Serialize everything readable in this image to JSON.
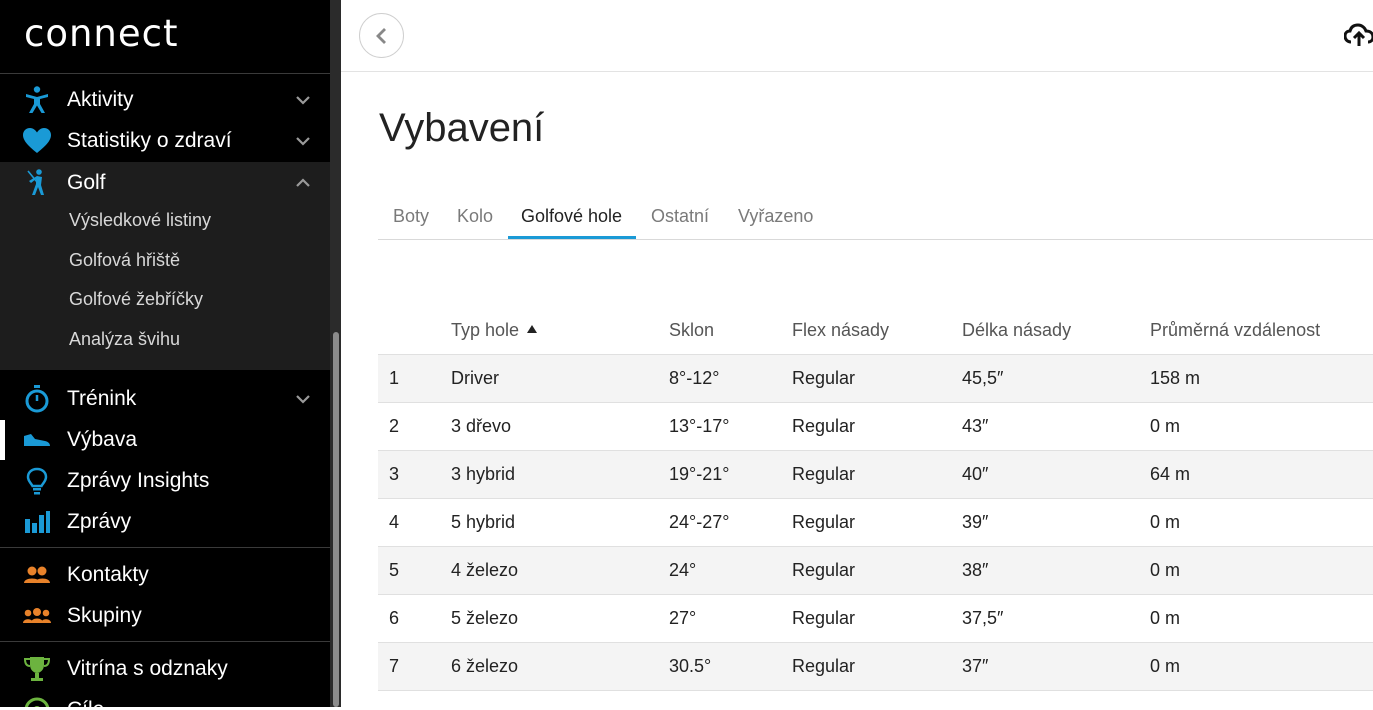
{
  "app": {
    "logo_text": "connect"
  },
  "sidebar": {
    "items": [
      {
        "label": "Aktivity",
        "icon": "running-figure-icon",
        "expandable": true,
        "expanded": false
      },
      {
        "label": "Statistiky o zdraví",
        "icon": "heart-icon",
        "expandable": true,
        "expanded": false
      },
      {
        "label": "Golf",
        "icon": "golfer-icon",
        "expandable": true,
        "expanded": true
      },
      {
        "label": "Trénink",
        "icon": "stopwatch-icon",
        "expandable": true,
        "expanded": false
      },
      {
        "label": "Výbava",
        "icon": "shoe-icon",
        "active": true
      },
      {
        "label": "Zprávy Insights",
        "icon": "lightbulb-icon"
      },
      {
        "label": "Zprávy",
        "icon": "bar-chart-icon"
      },
      {
        "label": "Kontakty",
        "icon": "contacts-icon"
      },
      {
        "label": "Skupiny",
        "icon": "groups-icon"
      },
      {
        "label": "Vitrína s odznaky",
        "icon": "trophy-icon"
      },
      {
        "label": "Cíle",
        "icon": "target-icon"
      }
    ],
    "golf_subitems": [
      "Výsledkové listiny",
      "Golfová hřiště",
      "Golfové žebříčky",
      "Analýza švihu"
    ],
    "colors": {
      "blue": "#1a9ad6",
      "orange": "#e8822a",
      "green": "#6cb33f"
    }
  },
  "main": {
    "title": "Vybavení",
    "tabs": [
      "Boty",
      "Kolo",
      "Golfové hole",
      "Ostatní",
      "Vyřazeno"
    ],
    "active_tab": "Golfové hole",
    "table": {
      "headers": [
        "",
        "Typ hole",
        "Sklon",
        "Flex násady",
        "Délka násady",
        "Průměrná vzdálenost"
      ],
      "sorted_by": "Typ hole",
      "rows": [
        [
          "1",
          "Driver",
          "8°-12°",
          "Regular",
          "45,5″",
          "158 m"
        ],
        [
          "2",
          "3 dřevo",
          "13°-17°",
          "Regular",
          "43″",
          "0 m"
        ],
        [
          "3",
          "3 hybrid",
          "19°-21°",
          "Regular",
          "40″",
          "64 m"
        ],
        [
          "4",
          "5 hybrid",
          "24°-27°",
          "Regular",
          "39″",
          "0 m"
        ],
        [
          "5",
          "4 železo",
          "24°",
          "Regular",
          "38″",
          "0 m"
        ],
        [
          "6",
          "5 železo",
          "27°",
          "Regular",
          "37,5″",
          "0 m"
        ],
        [
          "7",
          "6 železo",
          "30.5°",
          "Regular",
          "37″",
          "0 m"
        ]
      ]
    }
  }
}
